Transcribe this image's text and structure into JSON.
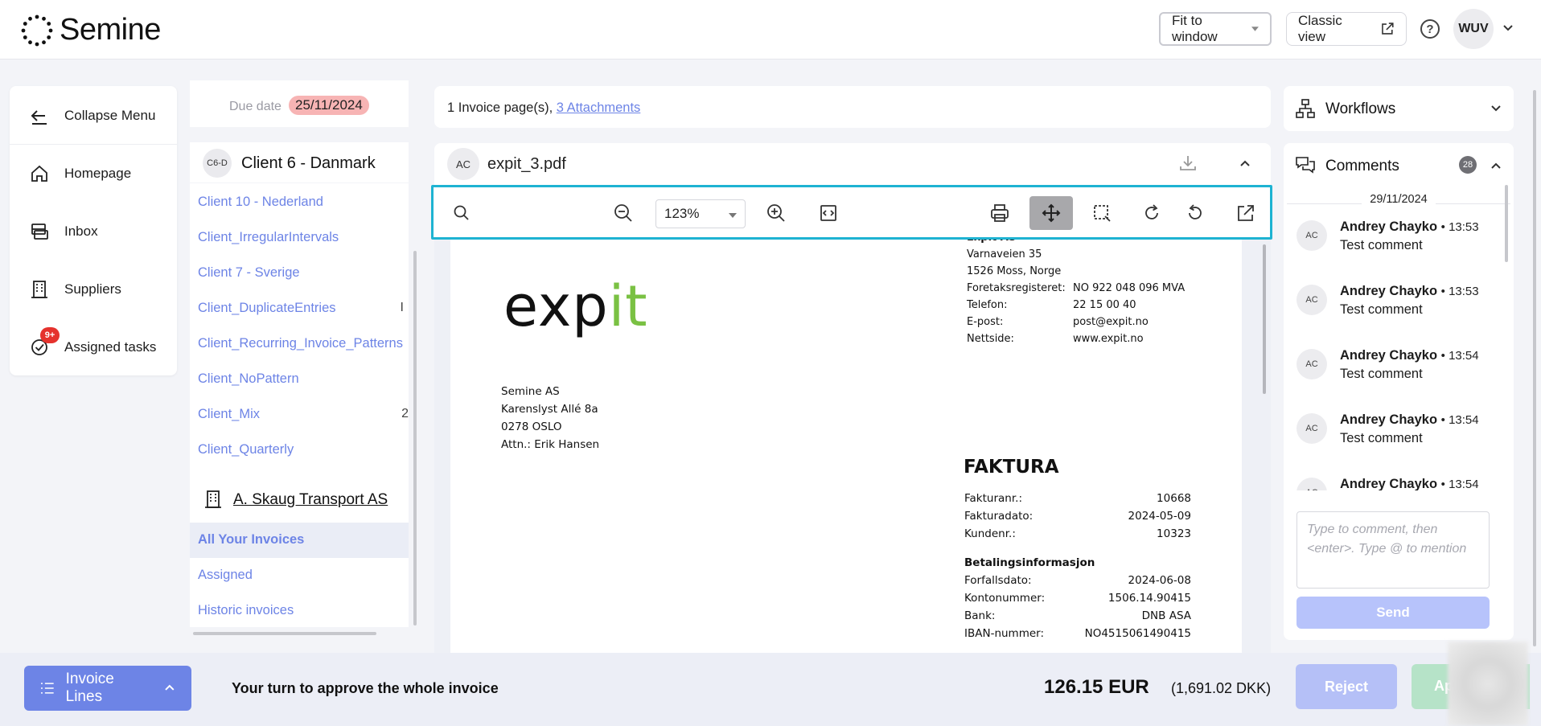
{
  "app": {
    "name": "Semine"
  },
  "topbar": {
    "fit_label": "Fit to window",
    "classic_label": "Classic view",
    "user_initials": "WUV"
  },
  "menu": {
    "collapse": "Collapse Menu",
    "homepage": "Homepage",
    "inbox": "Inbox",
    "suppliers": "Suppliers",
    "tasks": "Assigned tasks",
    "tasks_badge": "9+"
  },
  "clients": {
    "due_label": "Due date",
    "due_date": "25/11/2024",
    "current_code": "C6-D",
    "current_name": "Client 6 - Danmark",
    "list": [
      {
        "name": "Client 10 - Nederland",
        "count": ""
      },
      {
        "name": "Client_IrregularIntervals",
        "count": ""
      },
      {
        "name": "Client 7 - Sverige",
        "count": ""
      },
      {
        "name": "Client_DuplicateEntries",
        "count": "I"
      },
      {
        "name": "Client_Recurring_Invoice_Patterns",
        "count": ""
      },
      {
        "name": "Client_NoPattern",
        "count": ""
      },
      {
        "name": "Client_Mix",
        "count": "2"
      },
      {
        "name": "Client_Quarterly",
        "count": ""
      }
    ],
    "supplier_name": "A. Skaug Transport AS",
    "supplier_links": [
      "All Your Invoices",
      "Assigned",
      "Historic invoices"
    ]
  },
  "viewer": {
    "pages_text": "1 Invoice page(s), ",
    "attachments_link": "3 Attachments",
    "file_initials": "AC",
    "file_name": "expit_3.pdf",
    "zoom": "123%"
  },
  "invoice": {
    "logo_main": "exp",
    "logo_accent": "it",
    "sender": {
      "name": "Expit AS",
      "street": "Varnaveien 35",
      "city": "1526 Moss, Norge",
      "rows": [
        {
          "k": "Foretaksregisteret:",
          "v": "NO 922 048 096 MVA"
        },
        {
          "k": "Telefon:",
          "v": "22 15 00 40"
        },
        {
          "k": "E-post:",
          "v": "post@expit.no"
        },
        {
          "k": "Nettside:",
          "v": "www.expit.no"
        }
      ]
    },
    "recipient": [
      "Semine AS",
      "Karenslyst Allé 8a",
      "0278 OSLO",
      "Attn.: Erik Hansen"
    ],
    "title": "FAKTURA",
    "details": [
      {
        "k": "Fakturanr.:",
        "v": "10668"
      },
      {
        "k": "Fakturadato:",
        "v": "2024-05-09"
      },
      {
        "k": "Kundenr.:",
        "v": "10323"
      }
    ],
    "payment_title": "Betalingsinformasjon",
    "payment": [
      {
        "k": "Forfallsdato:",
        "v": "2024-06-08"
      },
      {
        "k": "Kontonummer:",
        "v": "1506.14.90415"
      },
      {
        "k": "Bank:",
        "v": "DNB ASA"
      },
      {
        "k": "IBAN-nummer:",
        "v": "NO4515061490415"
      }
    ]
  },
  "workflows": {
    "title": "Workflows"
  },
  "comments": {
    "title": "Comments",
    "count": "28",
    "date": "29/11/2024",
    "items": [
      {
        "initials": "AC",
        "author": "Andrey Chayko",
        "time": "13:53",
        "text": "Test comment"
      },
      {
        "initials": "AC",
        "author": "Andrey Chayko",
        "time": "13:53",
        "text": "Test comment"
      },
      {
        "initials": "AC",
        "author": "Andrey Chayko",
        "time": "13:54",
        "text": "Test comment"
      },
      {
        "initials": "AC",
        "author": "Andrey Chayko",
        "time": "13:54",
        "text": "Test comment"
      },
      {
        "initials": "AC",
        "author": "Andrey Chayko",
        "time": "13:54",
        "text": ""
      }
    ],
    "placeholder": "Type to comment, then <enter>. Type @ to mention",
    "send_label": "Send"
  },
  "bottom": {
    "lines_label": "Invoice Lines",
    "approve_text": "Your turn to approve the whole invoice",
    "amount": "126.15 EUR",
    "amount_dkk": "(1,691.02 DKK)",
    "reject_label": "Reject",
    "approve_label": "Approve"
  },
  "colors": {
    "accent": "#6d84e6",
    "toolbar_border": "#1eb3d2",
    "due_badge": "#f7b4b4",
    "expit_green": "#7ac143"
  }
}
